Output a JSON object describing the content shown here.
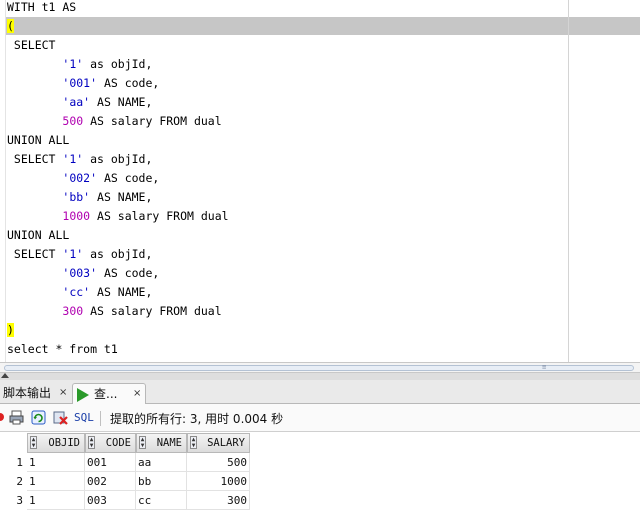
{
  "editor": {
    "lines": [
      {
        "segments": [
          {
            "t": "WITH t1 AS",
            "c": "kw"
          }
        ]
      },
      {
        "segments": [
          {
            "t": "(",
            "c": "paren"
          }
        ]
      },
      {
        "segments": [
          {
            "t": " SELECT",
            "c": "kw"
          }
        ]
      },
      {
        "segments": [
          {
            "t": "        ",
            "c": "kw"
          },
          {
            "t": "'1'",
            "c": "str"
          },
          {
            "t": " as objId,",
            "c": "kw"
          }
        ]
      },
      {
        "segments": [
          {
            "t": "        ",
            "c": "kw"
          },
          {
            "t": "'001'",
            "c": "str"
          },
          {
            "t": " AS code,",
            "c": "kw"
          }
        ]
      },
      {
        "segments": [
          {
            "t": "        ",
            "c": "kw"
          },
          {
            "t": "'aa'",
            "c": "str"
          },
          {
            "t": " AS NAME,",
            "c": "kw"
          }
        ]
      },
      {
        "segments": [
          {
            "t": "        ",
            "c": "kw"
          },
          {
            "t": "500",
            "c": "num"
          },
          {
            "t": " AS salary FROM dual",
            "c": "kw"
          }
        ]
      },
      {
        "segments": [
          {
            "t": "UNION ALL",
            "c": "kw"
          }
        ]
      },
      {
        "segments": [
          {
            "t": " SELECT ",
            "c": "kw"
          },
          {
            "t": "'1'",
            "c": "str"
          },
          {
            "t": " as objId,",
            "c": "kw"
          }
        ]
      },
      {
        "segments": [
          {
            "t": "        ",
            "c": "kw"
          },
          {
            "t": "'002'",
            "c": "str"
          },
          {
            "t": " AS code,",
            "c": "kw"
          }
        ]
      },
      {
        "segments": [
          {
            "t": "        ",
            "c": "kw"
          },
          {
            "t": "'bb'",
            "c": "str"
          },
          {
            "t": " AS NAME,",
            "c": "kw"
          }
        ]
      },
      {
        "segments": [
          {
            "t": "        ",
            "c": "kw"
          },
          {
            "t": "1000",
            "c": "num"
          },
          {
            "t": " AS salary FROM dual",
            "c": "kw"
          }
        ]
      },
      {
        "segments": [
          {
            "t": "UNION ALL",
            "c": "kw"
          }
        ]
      },
      {
        "segments": [
          {
            "t": " SELECT ",
            "c": "kw"
          },
          {
            "t": "'1'",
            "c": "str"
          },
          {
            "t": " as objId,",
            "c": "kw"
          }
        ]
      },
      {
        "segments": [
          {
            "t": "        ",
            "c": "kw"
          },
          {
            "t": "'003'",
            "c": "str"
          },
          {
            "t": " AS code,",
            "c": "kw"
          }
        ]
      },
      {
        "segments": [
          {
            "t": "        ",
            "c": "kw"
          },
          {
            "t": "'cc'",
            "c": "str"
          },
          {
            "t": " AS NAME,",
            "c": "kw"
          }
        ]
      },
      {
        "segments": [
          {
            "t": "        ",
            "c": "kw"
          },
          {
            "t": "300",
            "c": "num"
          },
          {
            "t": " AS salary FROM dual",
            "c": "kw"
          }
        ]
      },
      {
        "segments": [
          {
            "t": ")",
            "c": "paren"
          }
        ]
      },
      {
        "segments": [
          {
            "t": "select * from t1",
            "c": "kw"
          }
        ]
      }
    ]
  },
  "tabs": {
    "script_output": {
      "label": "脚本输出",
      "close": "×"
    },
    "query_result": {
      "label": "查...",
      "close": "×"
    }
  },
  "toolbar": {
    "sql_label": "SQL",
    "status": "提取的所有行: 3, 用时 0.004 秒"
  },
  "grid": {
    "columns": [
      "OBJID",
      "CODE",
      "NAME",
      "SALARY"
    ],
    "rows": [
      {
        "num": "1",
        "cells": [
          "1",
          "001",
          "aa",
          "500"
        ]
      },
      {
        "num": "2",
        "cells": [
          "1",
          "002",
          "bb",
          "1000"
        ]
      },
      {
        "num": "3",
        "cells": [
          "1",
          "003",
          "cc",
          "300"
        ]
      }
    ]
  },
  "colors": {
    "string": "#0000c0",
    "number": "#b000b0",
    "paren_highlight": "#ffff00",
    "current_line": "#c6c6c6"
  }
}
